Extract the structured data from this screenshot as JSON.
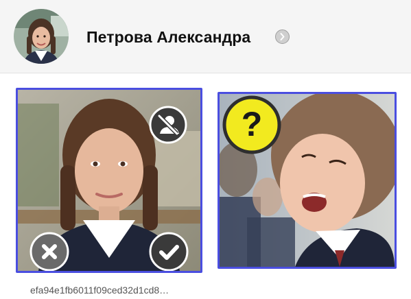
{
  "header": {
    "person_name": "Петрова Александра",
    "avatar_icon": "student-avatar",
    "details_icon": "chevron-right-icon"
  },
  "photos": [
    {
      "file_id": "efa94e1fb6011f09ced32d1cd8…",
      "actions": [
        "no-person-icon",
        "reject-icon",
        "accept-icon"
      ]
    },
    {
      "actions": [
        "question-mark-icon"
      ],
      "question_glyph": "?"
    }
  ],
  "colors": {
    "selection_border": "#4a4ee0",
    "header_background": "#f5f5f5",
    "question_badge": "#f2ea1f"
  }
}
